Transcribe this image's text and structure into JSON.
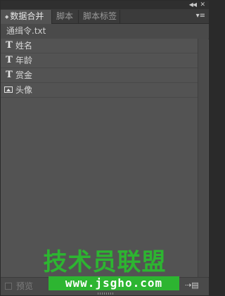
{
  "titlebar": {
    "collapse_icon": "double-chevron-left",
    "close_icon": "close-x"
  },
  "tabs": [
    {
      "label": "数据合并",
      "active": true
    },
    {
      "label": "脚本",
      "active": false
    },
    {
      "label": "脚本标签",
      "active": false
    }
  ],
  "panel_menu_icon": "panel-menu",
  "file": {
    "name": "通缉令.txt"
  },
  "fields": [
    {
      "label": "姓名",
      "type": "text",
      "icon": "T"
    },
    {
      "label": "年龄",
      "type": "text",
      "icon": "T"
    },
    {
      "label": "赏金",
      "type": "text",
      "icon": "T"
    },
    {
      "label": "头像",
      "type": "image",
      "icon": "image-icon"
    }
  ],
  "bottom": {
    "preview_label": "预览",
    "preview_checked": false
  },
  "watermark": {
    "title": "技术员联盟",
    "url": "www.jsgho.com",
    "color": "#2db531"
  }
}
